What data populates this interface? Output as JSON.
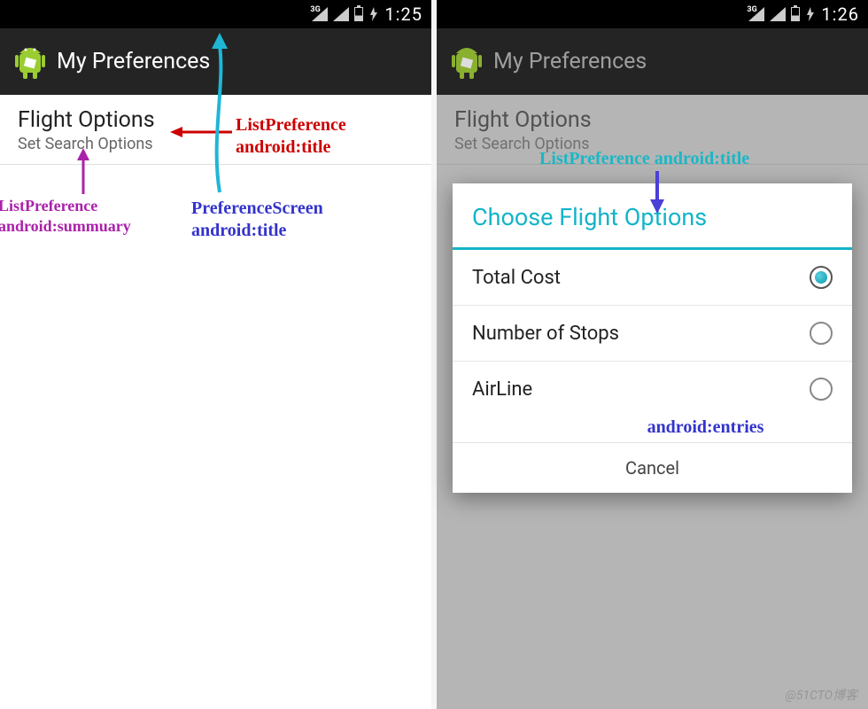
{
  "left": {
    "status": {
      "time": "1:25",
      "net": "3G"
    },
    "actionbar": {
      "title": "My Preferences"
    },
    "pref": {
      "title": "Flight Options",
      "summary": "Set Search Options"
    },
    "annot": {
      "lp_title": "ListPreference\nandroid:title",
      "ps_title": "PreferenceScreen\nandroid:title",
      "lp_summary": "ListPreference\nandroid:summuary"
    }
  },
  "right": {
    "status": {
      "time": "1:26",
      "net": "3G"
    },
    "actionbar": {
      "title": "My Preferences"
    },
    "pref": {
      "title": "Flight Options",
      "summary": "Set Search Options"
    },
    "dialog": {
      "title": "Choose Flight Options",
      "options": [
        "Total Cost",
        "Number of Stops",
        "AirLine"
      ],
      "selected": 0,
      "cancel": "Cancel"
    },
    "annot": {
      "lp_title": "ListPreference android:title",
      "entries": "android:entries"
    }
  },
  "watermark": "@51CTO博客"
}
